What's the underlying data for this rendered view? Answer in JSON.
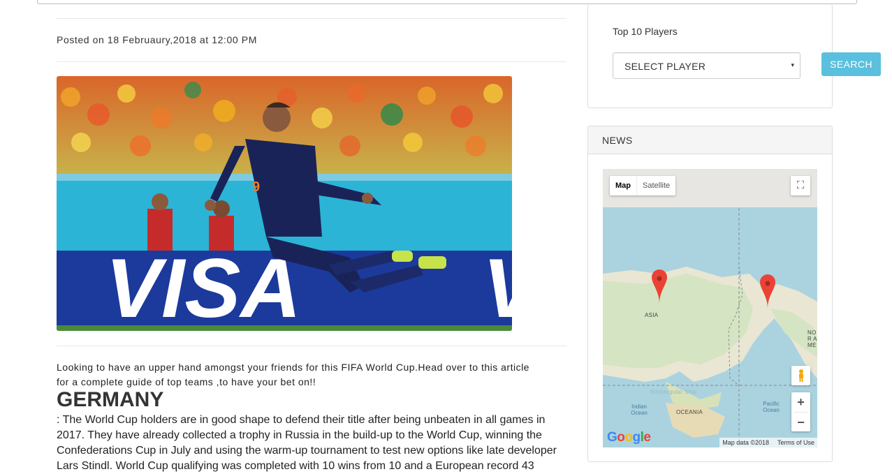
{
  "post": {
    "posted_text": "Posted on 18 Februaury,2018 at 12:00 PM",
    "intro_line1": "Looking to have an upper hand amongst your friends for this FIFA World Cup.Head over to this article",
    "intro_line2": "for a complete guide of top teams ,to have your bet on!!",
    "team_heading": "GERMANY",
    "team_text": ": The World Cup holders are in good shape to defend their title after being unbeaten in all games in 2017. They have already collected a trophy in Russia in the build-up to the World Cup, winning the Confederations Cup in July and using the warm-up tournament to test new options like late developer Lars Stindl. World Cup qualifying was completed with 10 wins from 10 and a European record 43"
  },
  "hero_image": {
    "sponsor_text": "VISA",
    "jersey_number": "9"
  },
  "sidebar": {
    "players": {
      "label": "Top 10 Players",
      "select_value": "SELECT PLAYER",
      "caret": "▾",
      "search_label": "SEARCH"
    },
    "news": {
      "title": "NEWS",
      "map": {
        "map_tab": "Map",
        "satellite_tab": "Satellite",
        "fullscreen_icon": "⛶",
        "zoom_in": "+",
        "zoom_out": "−",
        "google_logo": "Google",
        "attribution": "Map data ©2018",
        "terms": "Terms of Use",
        "labels": {
          "asia": "ASIA",
          "north_america": "NOR AME",
          "oceania": "OCEANIA",
          "indian_ocean": "Indian Ocean",
          "pacific_ocean": "Pacific Ocean",
          "rectangular_ship": "Rectangular Ship"
        },
        "marker_color": "#ea4335"
      }
    }
  },
  "colors": {
    "search_button": "#5bc0de",
    "panel_border": "#dddddd"
  }
}
